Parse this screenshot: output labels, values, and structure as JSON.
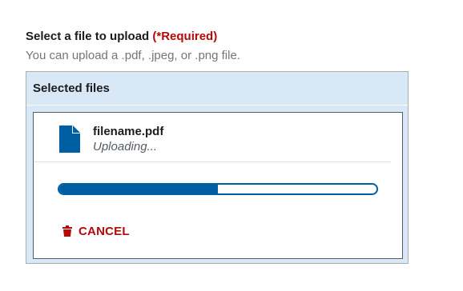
{
  "field": {
    "label": "Select a file to upload",
    "required": "(*Required)",
    "hint": "You can upload a .pdf, .jpeg, or .png file."
  },
  "dropzone": {
    "header": "Selected files"
  },
  "file": {
    "icon": "file-icon",
    "name": "filename.pdf",
    "status": "Uploading...",
    "progress": 0.5
  },
  "actions": {
    "cancel_label": "CANCEL",
    "cancel_icon": "trash-icon"
  },
  "colors": {
    "accent": "#005ea2",
    "danger": "#b50909",
    "panel": "#d9e8f6"
  }
}
